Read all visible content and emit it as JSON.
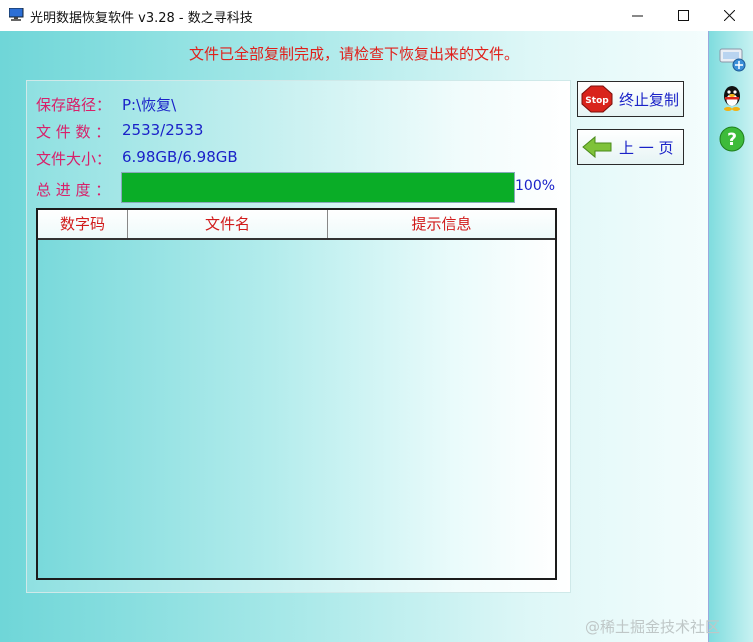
{
  "window": {
    "title": "光明数据恢复软件 v3.28 - 数之寻科技",
    "minimize_icon": "minimize-icon",
    "maximize_icon": "maximize-icon",
    "close_icon": "close-icon"
  },
  "status_message": "文件已全部复制完成，请检查下恢复出来的文件。",
  "info": {
    "save_path_label": "保存路径：",
    "save_path_value": "P:\\恢复\\",
    "file_count_label": "文 件 数 ：",
    "file_count_value": "2533/2533",
    "file_size_label": "文件大小：",
    "file_size_value": "6.98GB/6.98GB",
    "progress_label": "总 进 度 ：",
    "progress_percent_text": "100%",
    "progress_fraction": 1.0
  },
  "table": {
    "columns": [
      "数字码",
      "文件名",
      "提示信息"
    ],
    "rows": []
  },
  "buttons": {
    "stop_label": "终止复制",
    "stop_icon_text": "Stop",
    "back_label": "上 一 页"
  },
  "sidebar_icons": [
    "network-icon",
    "qq-penguin-icon",
    "help-icon"
  ],
  "watermark": "@稀土掘金技术社区",
  "colors": {
    "status_red": "#e0201b",
    "label_pink": "#d8206a",
    "value_blue": "#1a22c8",
    "progress_green": "#0aad27"
  }
}
